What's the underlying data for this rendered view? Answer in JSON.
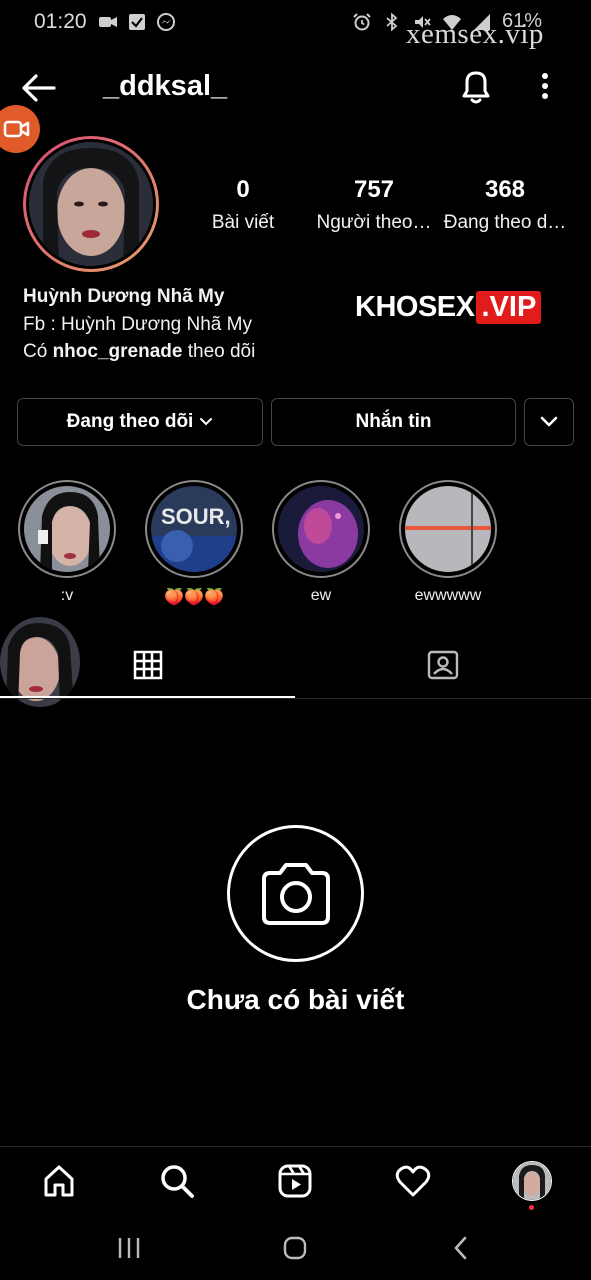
{
  "status_bar": {
    "time": "01:20",
    "battery": "61%",
    "left_icons": [
      "video-icon",
      "check-box-icon",
      "messenger-icon"
    ],
    "right_icons": [
      "alarm-icon",
      "bluetooth-icon",
      "mute-icon",
      "wifi-icon",
      "signal-icon"
    ]
  },
  "watermarks": {
    "top": "xemsex.vip",
    "mid_a": "KHOSEX",
    "mid_b": ".VIP"
  },
  "header": {
    "username": "_ddksal_",
    "back_icon": "arrow-left-icon",
    "notify_icon": "bell-icon",
    "more_icon": "more-vertical-icon"
  },
  "profile": {
    "stats": [
      {
        "value": "0",
        "label": "Bài viết"
      },
      {
        "value": "757",
        "label": "Người theo…"
      },
      {
        "value": "368",
        "label": "Đang theo d…"
      }
    ],
    "name": "Huỳnh Dương Nhã My",
    "bio_line": "Fb : Huỳnh Dương Nhã My",
    "followed_by_prefix": "Có",
    "followed_by_user": "nhoc_grenade",
    "followed_by_suffix": "theo dõi"
  },
  "actions": {
    "following": "Đang theo dõi",
    "message": "Nhắn tin",
    "suggest_icon": "chevron-down-icon"
  },
  "highlights": [
    {
      "label": ":v"
    },
    {
      "label": "🍑🍑🍑"
    },
    {
      "label": "ew"
    },
    {
      "label": "ewwwww"
    }
  ],
  "tabs": {
    "grid_icon": "grid-icon",
    "tagged_icon": "tagged-person-icon"
  },
  "empty_state": {
    "icon": "camera-icon",
    "text": "Chưa có bài viết"
  },
  "bottom_nav": {
    "items": [
      "home-icon",
      "search-icon",
      "reels-icon",
      "heart-icon",
      "profile-avatar"
    ]
  },
  "system_nav": {
    "items": [
      "recents-icon",
      "home-button-icon",
      "back-chevron-icon"
    ]
  },
  "colors": {
    "background": "#000000",
    "avatar_ring_start": "#d94a73",
    "avatar_ring_end": "#e7a06a",
    "video_fab": "#e15b2a",
    "watermark_red": "#e21b1b",
    "notification_dot": "#ff3040"
  }
}
